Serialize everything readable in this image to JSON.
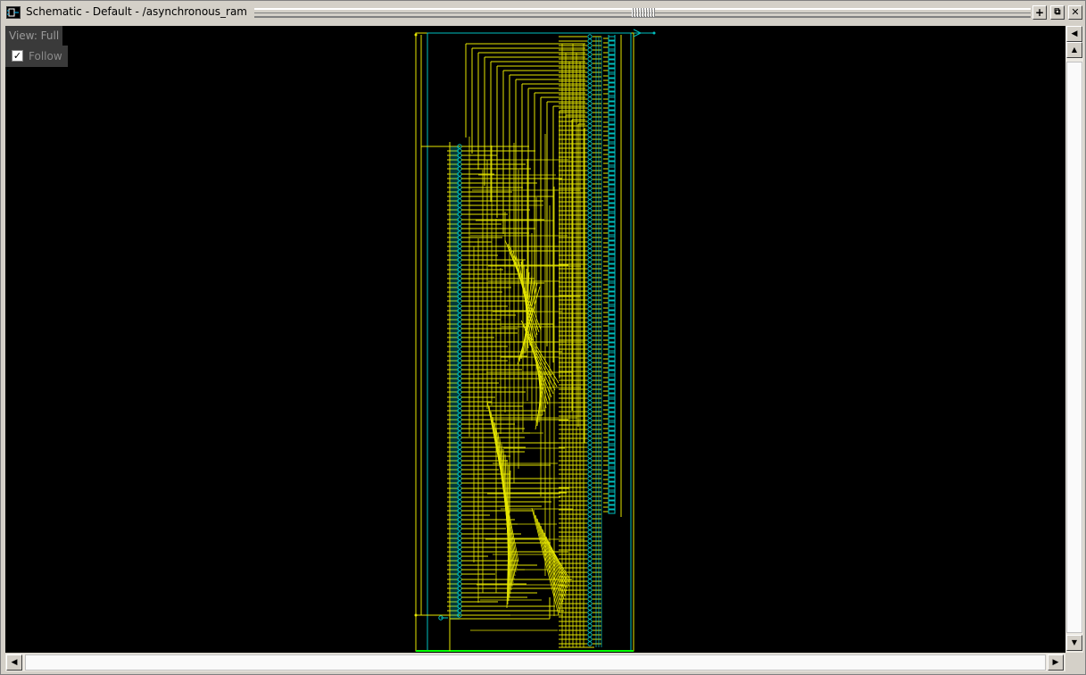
{
  "window": {
    "title": "Schematic - Default  - /asynchronous_ram",
    "icon": "schematic-window-icon",
    "buttons": {
      "add": "+",
      "undock": "⧉",
      "close": "✕"
    }
  },
  "overlay": {
    "view_label": "View: Full",
    "follow_label": "Follow",
    "follow_checked": "✓"
  },
  "scrollbars": {
    "up": "▲",
    "down": "▼",
    "left": "◀",
    "right": "▶",
    "prev_page": "◀"
  },
  "colors": {
    "wire": "#e6e600",
    "instance": "#00c0c0",
    "highlight": "#00ff00",
    "background": "#000000"
  }
}
